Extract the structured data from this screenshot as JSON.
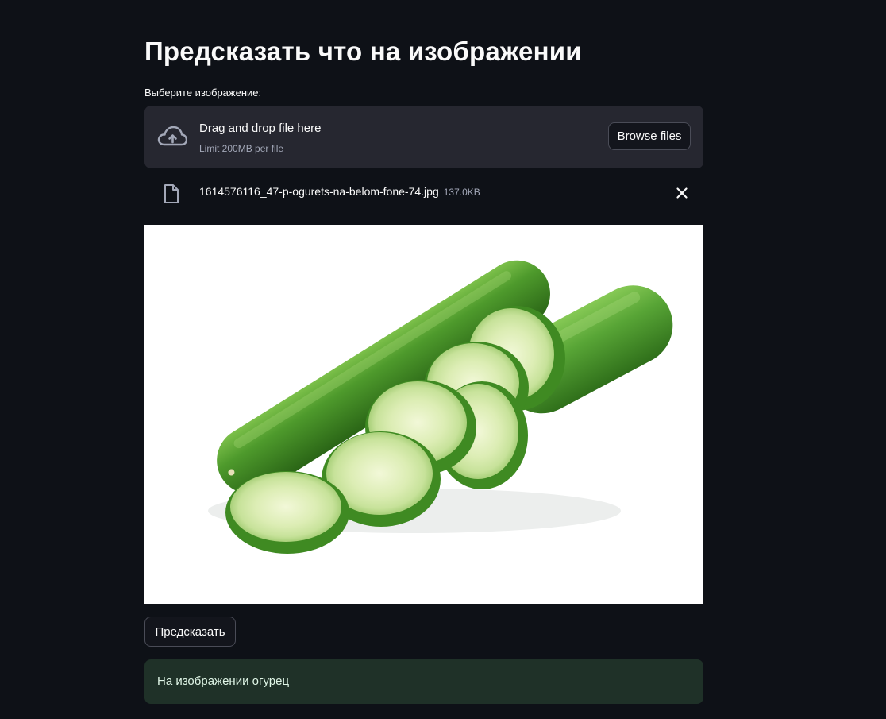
{
  "page": {
    "title": "Предсказать что на изображении"
  },
  "uploader": {
    "label": "Выберите изображение:",
    "dropzone_title": "Drag and drop file here",
    "dropzone_limit": "Limit 200MB per file",
    "browse_label": "Browse files",
    "icon": "cloud-upload-icon"
  },
  "file": {
    "name": "1614576116_47-p-ogurets-na-belom-fone-74.jpg",
    "size": "137.0KB",
    "icon": "file-icon",
    "remove_icon": "close-icon"
  },
  "preview": {
    "subject": "cucumber with slices on white background"
  },
  "actions": {
    "predict_label": "Предсказать"
  },
  "result": {
    "text": "На изображении огурец"
  },
  "colors": {
    "background": "#0e1117",
    "panel": "#262730",
    "success_bg": "#1f3128",
    "success_text": "#dff5e6"
  }
}
